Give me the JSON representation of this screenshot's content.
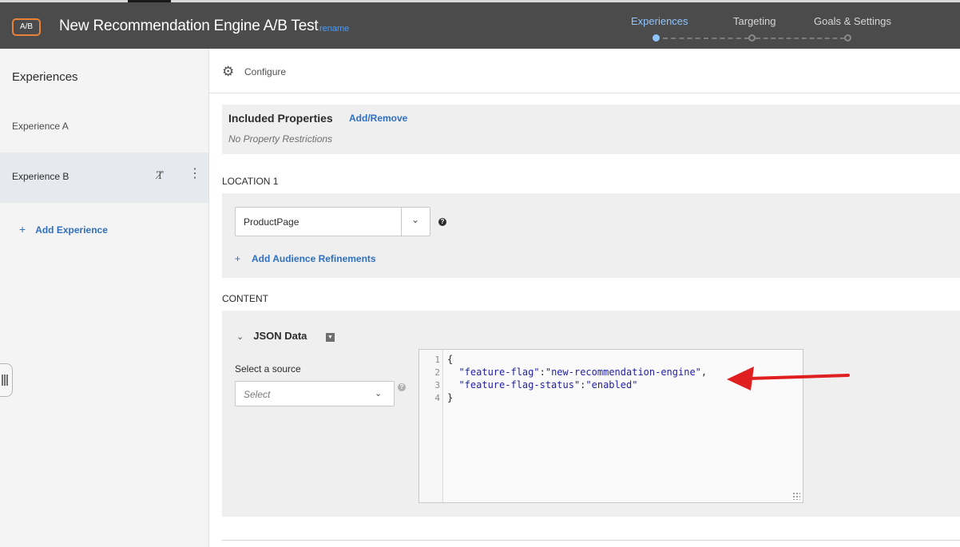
{
  "header": {
    "badge": "A/B",
    "title": "New Recommendation Engine A/B Test",
    "rename": "rename",
    "steps": [
      {
        "label": "Experiences",
        "active": true
      },
      {
        "label": "Targeting",
        "active": false
      },
      {
        "label": "Goals & Settings",
        "active": false
      }
    ]
  },
  "sidebar": {
    "title": "Experiences",
    "items": [
      {
        "label": "Experience A"
      },
      {
        "label": "Experience B"
      }
    ],
    "add_label": "Add Experience"
  },
  "configure": {
    "label": "Configure"
  },
  "included": {
    "title": "Included Properties",
    "link": "Add/Remove",
    "subtitle": "No Property Restrictions"
  },
  "location": {
    "label": "LOCATION 1",
    "selected": "ProductPage",
    "refine": "Add Audience Refinements"
  },
  "content": {
    "label": "CONTENT",
    "json_header": "JSON Data",
    "source_label": "Select a source",
    "source_placeholder": "Select",
    "editor_lines": [
      {
        "num": "1",
        "text": "{"
      },
      {
        "num": "2",
        "key": "\"feature-flag\"",
        "value": "\"new-recommendation-engine\"",
        "suffix": ","
      },
      {
        "num": "3",
        "key": "\"feature-flag-status\"",
        "value": "\"enabled\"",
        "suffix": ""
      },
      {
        "num": "4",
        "text": "}"
      }
    ]
  },
  "colors": {
    "accent": "#2f6fbf",
    "header_bg": "#4b4b4b",
    "active_step": "#8fc4ff",
    "arrow": "#e02020"
  }
}
